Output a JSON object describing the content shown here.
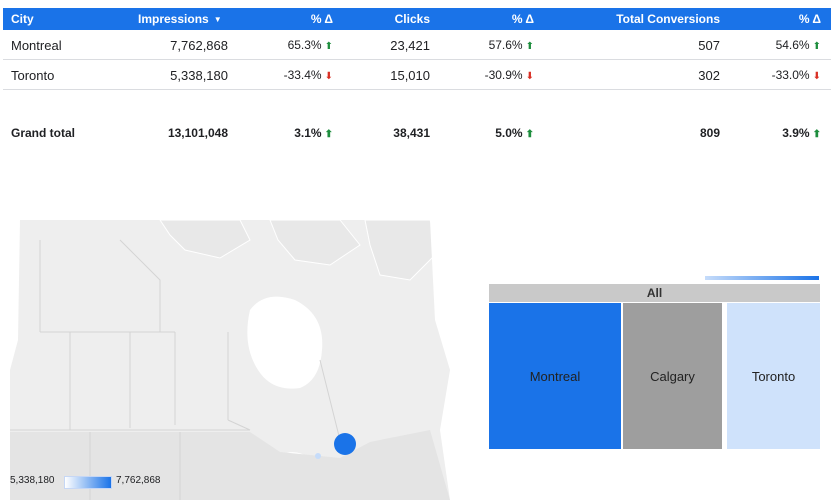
{
  "table": {
    "headers": {
      "city": "City",
      "impressions": "Impressions",
      "impressions_delta": "% Δ",
      "clicks": "Clicks",
      "clicks_delta": "% Δ",
      "conversions": "Total Conversions",
      "conversions_delta": "% Δ"
    },
    "rows": [
      {
        "city": "Montreal",
        "impressions": "7,762,868",
        "impressions_delta": "65.3%",
        "impressions_trend": "up",
        "clicks": "23,421",
        "clicks_delta": "57.6%",
        "clicks_trend": "up",
        "conversions": "507",
        "conversions_delta": "54.6%",
        "conversions_trend": "up"
      },
      {
        "city": "Toronto",
        "impressions": "5,338,180",
        "impressions_delta": "-33.4%",
        "impressions_trend": "down",
        "clicks": "15,010",
        "clicks_delta": "-30.9%",
        "clicks_trend": "down",
        "conversions": "302",
        "conversions_delta": "-33.0%",
        "conversions_trend": "down"
      }
    ],
    "grand_total": {
      "label": "Grand total",
      "impressions": "13,101,048",
      "impressions_delta": "3.1%",
      "clicks": "38,431",
      "clicks_delta": "5.0%",
      "conversions": "809",
      "conversions_delta": "3.9%"
    }
  },
  "map": {
    "legend_min": "5,338,180",
    "legend_max": "7,762,868",
    "bubbles": [
      {
        "city": "Montreal",
        "value": 7762868,
        "color": "#1a73e8"
      },
      {
        "city": "Toronto",
        "value": 5338180,
        "color": "#c6dcfa"
      }
    ]
  },
  "treemap": {
    "root_label": "All",
    "tiles": [
      {
        "label": "Montreal",
        "color": "#1a73e8"
      },
      {
        "label": "Calgary",
        "color": "#9e9e9e"
      },
      {
        "label": "Toronto",
        "color": "#cfe2fb"
      }
    ]
  },
  "colors": {
    "header": "#1a73e8",
    "up": "#1e8e3e",
    "down": "#d93025"
  }
}
